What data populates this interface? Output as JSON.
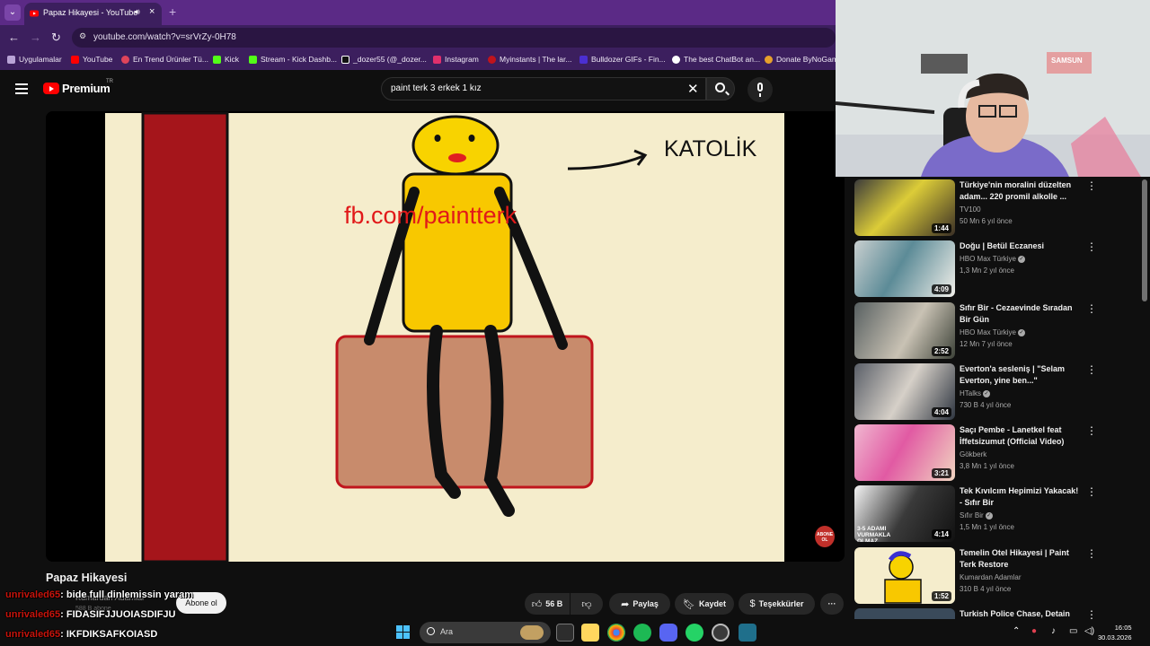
{
  "browser": {
    "tab_title": "Papaz Hikayesi - YouTube",
    "url": "youtube.com/watch?v=srVrZy-0H78",
    "bookmarks": [
      {
        "label": "Uygulamalar",
        "color": "#b9a3d6"
      },
      {
        "label": "YouTube",
        "color": "#ff0000"
      },
      {
        "label": "En Trend Ürünler Tü...",
        "color": "#e0445a"
      },
      {
        "label": "Kick",
        "color": "#53fc18"
      },
      {
        "label": "Stream - Kick Dashb...",
        "color": "#53fc18"
      },
      {
        "label": "_dozer55 (@_dozer...",
        "color": "#111111"
      },
      {
        "label": "Instagram",
        "color": "#e1306c"
      },
      {
        "label": "Myinstants | The lar...",
        "color": "#c0141c"
      },
      {
        "label": "Bulldozer GIFs - Fin...",
        "color": "#4b2fd1"
      },
      {
        "label": "The best ChatBot an...",
        "color": "#ffffff"
      },
      {
        "label": "Donate ByNoGam",
        "color": "#e6a02c"
      }
    ]
  },
  "youtube": {
    "logo_text": "Premium",
    "region": "TR",
    "search_query": "paint terk 3 erkek 1 kız",
    "video": {
      "title": "Papaz Hikayesi",
      "overlay_text_1": "fb.com/paintterk",
      "overlay_text_2": "KATOLİK",
      "subscribe_badge": "ABONE OL"
    },
    "channel": {
      "name": "Kumardan Adamlar",
      "subscribers": "588 B abone",
      "subscribe_label": "Abone ol"
    },
    "actions": {
      "likes": "56 B",
      "share": "Paylaş",
      "save": "Kaydet",
      "thanks": "Teşekkürler",
      "more": "···"
    },
    "recommendations": [
      {
        "title": "Türkiye'nin moralini düzelten adam... 220 promil alkolle ...",
        "channel": "TV100",
        "verified": false,
        "meta": "50 Mn  6 yıl önce",
        "duration": "1:44"
      },
      {
        "title": "Doğu | Betül Eczanesi",
        "channel": "HBO Max Türkiye",
        "verified": true,
        "meta": "1,3 Mn  2 yıl önce",
        "duration": "4:09"
      },
      {
        "title": "Sıfır Bir - Cezaevinde Sıradan Bir Gün",
        "channel": "HBO Max Türkiye",
        "verified": true,
        "meta": "12 Mn  7 yıl önce",
        "duration": "2:52"
      },
      {
        "title": "Everton'a sesleniş | \"Selam Everton, yine ben...\"",
        "channel": "HTalks",
        "verified": true,
        "meta": "730 B  4 yıl önce",
        "duration": "4:04"
      },
      {
        "title": "Saçı Pembe - Lanetkel feat İffetsizumut (Official Video)",
        "channel": "Gökberk",
        "verified": false,
        "meta": "3,8 Mn  1 yıl önce",
        "duration": "3:21"
      },
      {
        "title": "Tek Kıvılcım Hepimizi Yakacak! - Sıfır Bir",
        "channel": "Sıfır Bir",
        "verified": true,
        "meta": "1,5 Mn  1 yıl önce",
        "duration": "4:14"
      },
      {
        "title": "Temelin Otel Hikayesi | Paint Terk Restore",
        "channel": "Kumardan Adamlar",
        "verified": false,
        "meta": "310 B  4 yıl önce",
        "duration": "1:52"
      },
      {
        "title": "Turkish Police Chase, Detain",
        "channel": "",
        "verified": false,
        "meta": "",
        "duration": ""
      }
    ],
    "thumb_caption": "3-5 ADAMI VURMAKLA OLMAZ"
  },
  "chat": [
    {
      "user": "unrivaled65",
      "message": ": bide full dinlemissin yaram"
    },
    {
      "user": "unrivaled65",
      "message": ": FIDASIFJJUOIASDIFJU"
    },
    {
      "user": "unrivaled65",
      "message": ": IKFDIKSAFKOIASD"
    }
  ],
  "webcam": {
    "sign_text": "SAMSUN"
  },
  "taskbar": {
    "search_placeholder": "Ara",
    "time": "16:05",
    "date": "30.03.2026"
  }
}
